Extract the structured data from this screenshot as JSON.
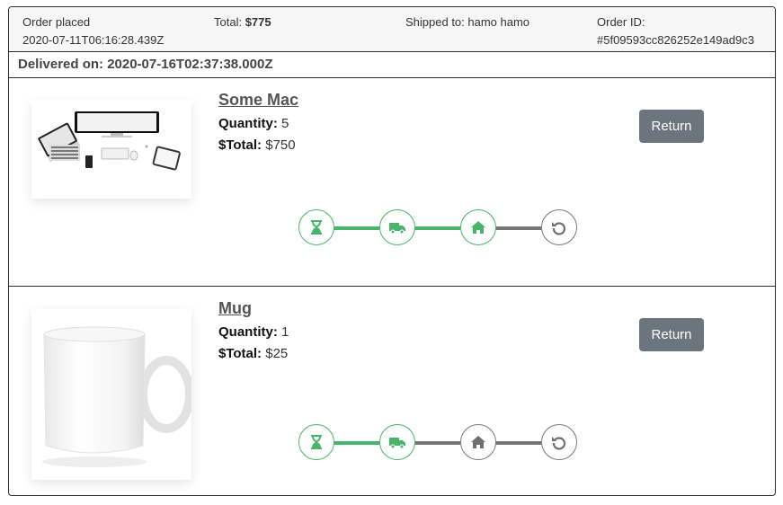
{
  "header": {
    "order_placed_label": "Order placed",
    "order_placed_value": "2020-07-11T06:16:28.439Z",
    "total_label": "Total: ",
    "total_value": "$775",
    "shipped_label": "Shipped to: ",
    "shipped_value": "hamo hamo",
    "order_id_label": "Order ID:",
    "order_id_value": "#5f09593cc826252e149ad9c3"
  },
  "delivered": "Delivered on: 2020-07-16T02:37:38.000Z",
  "items": [
    {
      "name": "Some Mac",
      "quantity_label": "Quantity:",
      "quantity": "5",
      "total_label": "$Total:",
      "total": "$750",
      "return_label": "Return",
      "image": "laptop-desk-setup",
      "progress_steps_done": 3
    },
    {
      "name": "Mug",
      "quantity_label": "Quantity:",
      "quantity": "1",
      "total_label": "$Total:",
      "total": "$25",
      "return_label": "Return",
      "image": "white-mug",
      "progress_steps_done": 2
    }
  ],
  "tracker_steps": [
    "hourglass-icon",
    "truck-icon",
    "home-icon",
    "undo-icon"
  ],
  "colors": {
    "done": "#49b56b",
    "pending": "#777777",
    "button": "#6c757d"
  }
}
